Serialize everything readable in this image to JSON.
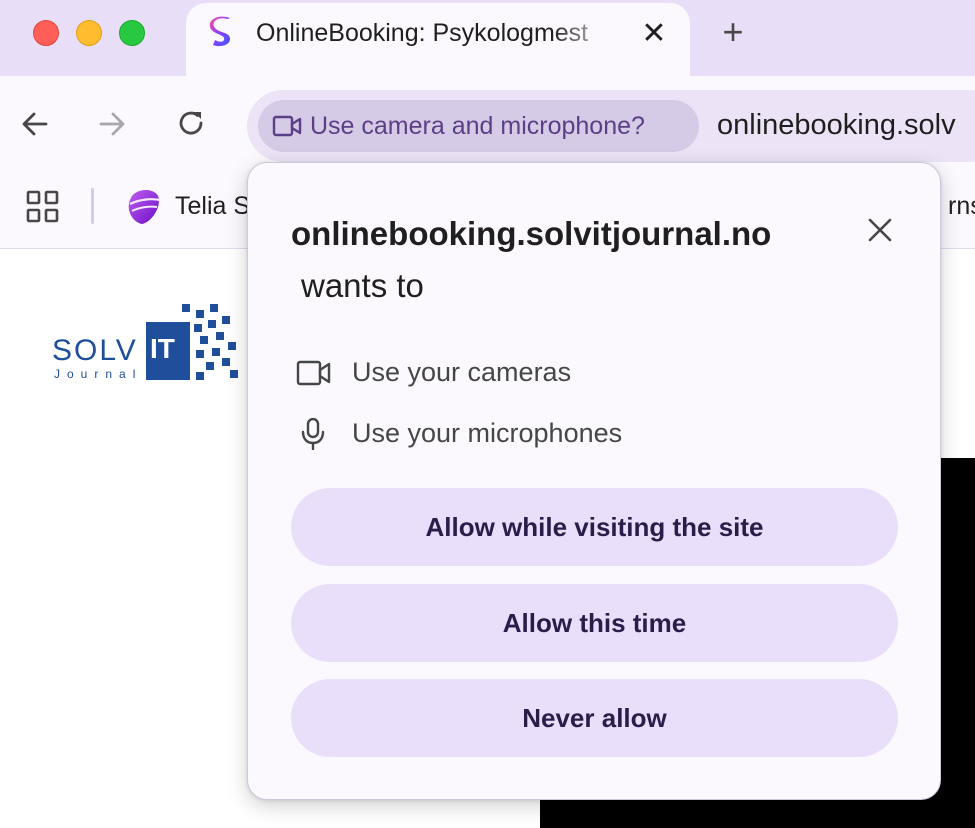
{
  "tab": {
    "title": "OnlineBooking: Psykologmest",
    "close_glyph": "✕",
    "new_tab_glyph": "+"
  },
  "toolbar": {
    "permission_chip_label": "Use camera and microphone?",
    "url": "onlinebooking.solv"
  },
  "bookmarks": {
    "items": [
      {
        "label": "Telia S"
      },
      {
        "label": "rns"
      }
    ]
  },
  "page": {
    "logo_text_main": "SOLV",
    "logo_text_it": "IT",
    "logo_text_sub": "Journal"
  },
  "popup": {
    "origin": "onlinebooking.solvitjournal.no",
    "wants_to": "wants to",
    "permissions": [
      {
        "label": "Use your cameras",
        "icon": "camera-icon"
      },
      {
        "label": "Use your microphones",
        "icon": "microphone-icon"
      }
    ],
    "buttons": {
      "allow_while_visiting": "Allow while visiting the site",
      "allow_this_time": "Allow this time",
      "never_allow": "Never allow"
    }
  },
  "colors": {
    "tab_strip": "#e9def7",
    "chrome_surface": "#fbf8fe",
    "chip_background": "#d6cbe7",
    "chip_text": "#5b3f86",
    "popup_button": "#eadffa",
    "popup_button_text": "#2c1c4a",
    "logo_blue": "#1f4e9a"
  }
}
